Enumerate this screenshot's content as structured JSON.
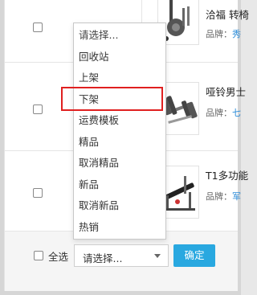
{
  "rows": [
    {
      "product_name": "洽福 转椅",
      "brand_label": "品牌：",
      "brand_value": "秀"
    },
    {
      "product_name": "哑铃男士",
      "brand_label": "品牌：",
      "brand_value": "七"
    },
    {
      "product_name": "T1多功能",
      "brand_label": "品牌：",
      "brand_value": "军"
    }
  ],
  "dropdown": {
    "options": [
      "请选择...",
      "回收站",
      "上架",
      "下架",
      "运费模板",
      "精品",
      "取消精品",
      "新品",
      "取消新品",
      "热销"
    ],
    "highlighted_option": "运费模板"
  },
  "footer": {
    "select_all_label": "全选",
    "select_value": "请选择...",
    "confirm_label": "确定"
  },
  "colors": {
    "confirm_button": "#29a8e0",
    "highlight_box": "#e02020",
    "brand_link": "#2a8bd8"
  }
}
